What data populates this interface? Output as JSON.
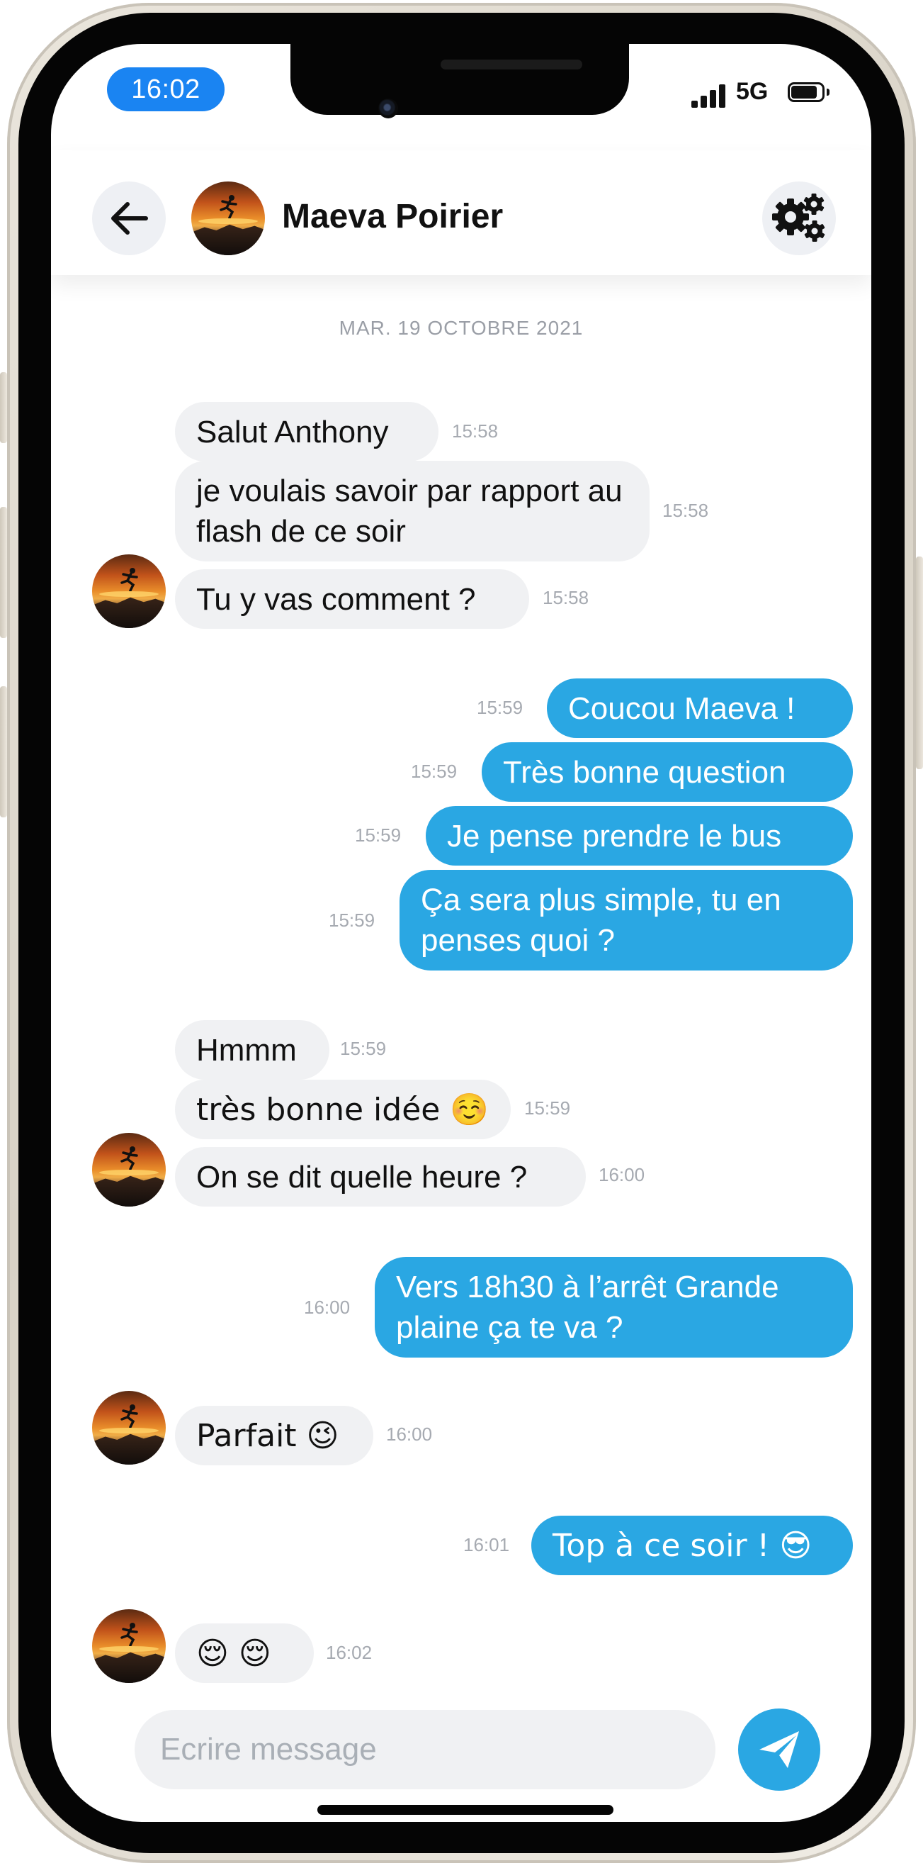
{
  "status_bar": {
    "time": "16:02",
    "network": "5G"
  },
  "header": {
    "contact_name": "Maeva Poirier",
    "back_icon": "arrow-left-icon",
    "settings_icon": "gears-icon"
  },
  "conversation": {
    "date_separator": "MAR. 19 OCTOBRE 2021",
    "messages": [
      {
        "direction": "in",
        "text": "Salut Anthony",
        "time": "15:58"
      },
      {
        "direction": "in",
        "text": "je voulais savoir par rapport au flash de ce soir",
        "time": "15:58"
      },
      {
        "direction": "in",
        "text": "Tu y vas comment ?",
        "time": "15:58"
      },
      {
        "direction": "out",
        "text": "Coucou Maeva !",
        "time": "15:59"
      },
      {
        "direction": "out",
        "text": "Très bonne question",
        "time": "15:59"
      },
      {
        "direction": "out",
        "text": "Je pense prendre le bus",
        "time": "15:59"
      },
      {
        "direction": "out",
        "text": "Ça sera plus simple, tu en penses quoi ?",
        "time": "15:59"
      },
      {
        "direction": "in",
        "text": "Hmmm",
        "time": "15:59"
      },
      {
        "direction": "in",
        "text": "très bonne idée ☺️",
        "time": "15:59"
      },
      {
        "direction": "in",
        "text": "On se dit quelle heure ?",
        "time": "16:00"
      },
      {
        "direction": "out",
        "text": "Vers 18h30 à l’arrêt Grande plaine  ça te va ?",
        "time": "16:00"
      },
      {
        "direction": "in",
        "text": "Parfait 😉",
        "time": "16:00"
      },
      {
        "direction": "out",
        "text": "Top à ce soir ! 😎",
        "time": "16:01"
      },
      {
        "direction": "in",
        "text": "😌 😌",
        "time": "16:02"
      }
    ]
  },
  "composer": {
    "placeholder": "Ecrire message",
    "send_icon": "paper-plane-icon"
  },
  "colors": {
    "accent": "#2aa7e3",
    "status_pill": "#1a84f2",
    "incoming_bubble": "#f0f1f3"
  }
}
